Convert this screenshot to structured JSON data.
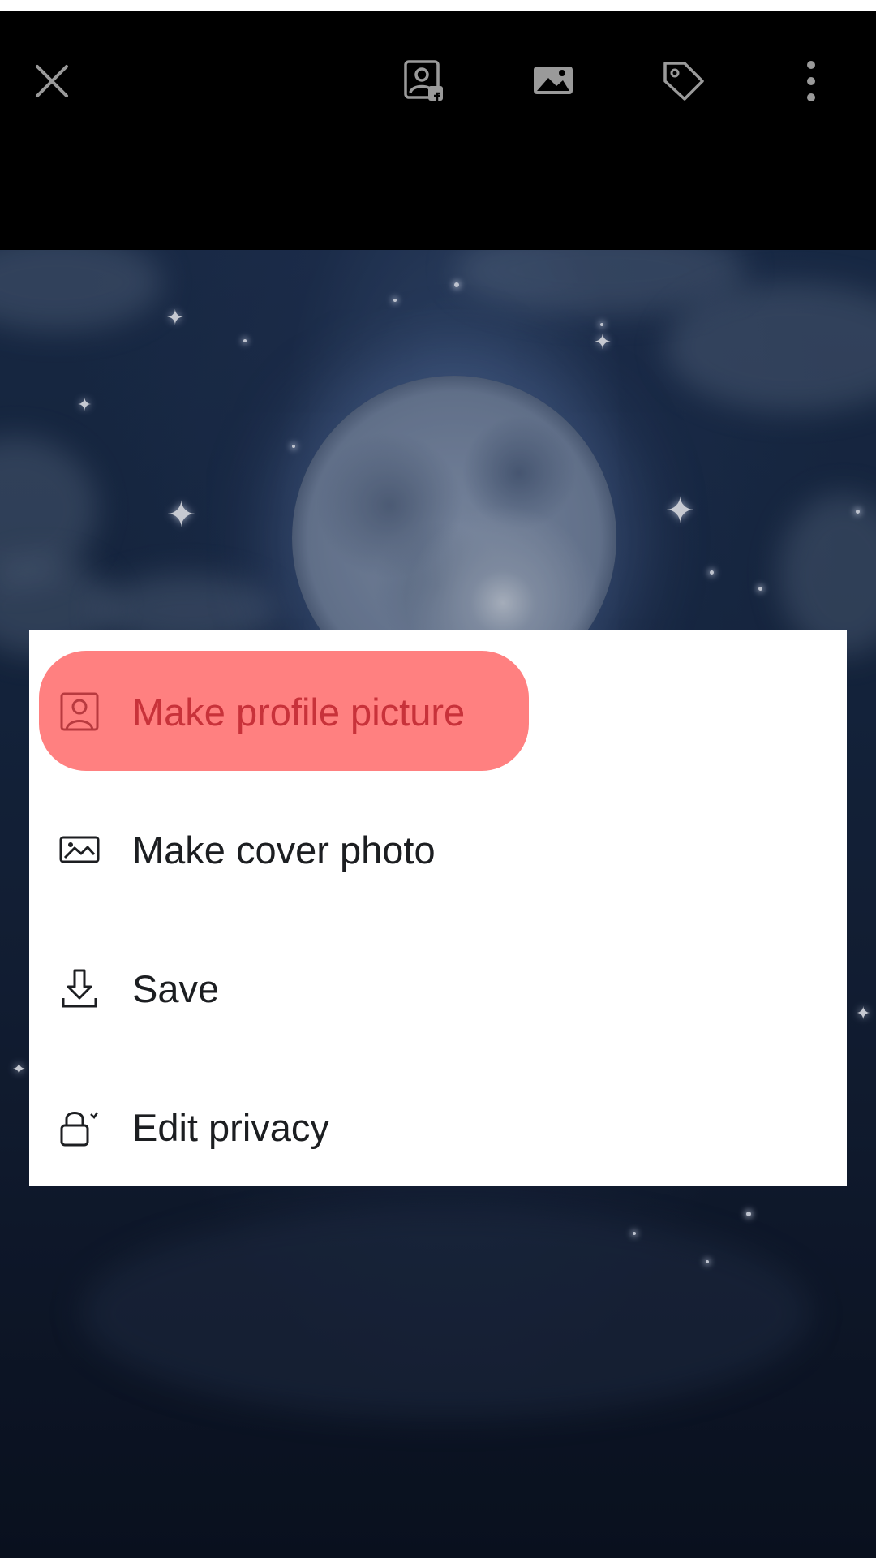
{
  "topbar": {
    "close_icon": "close-icon",
    "profile_icon": "profile-frame-icon",
    "photo_icon": "photo-icon",
    "tag_icon": "tag-icon",
    "more_icon": "more-vertical-icon"
  },
  "menu": {
    "items": [
      {
        "label": "Make profile picture",
        "icon": "profile-picture-icon",
        "highlighted": true
      },
      {
        "label": "Make cover photo",
        "icon": "cover-photo-icon"
      },
      {
        "label": "Save",
        "icon": "download-icon"
      },
      {
        "label": "Edit privacy",
        "icon": "lock-icon"
      }
    ]
  },
  "colors": {
    "highlight": "#ff8080",
    "highlight_text": "#c8323a",
    "menu_bg": "#ffffff",
    "topbar_bg": "#000000"
  }
}
